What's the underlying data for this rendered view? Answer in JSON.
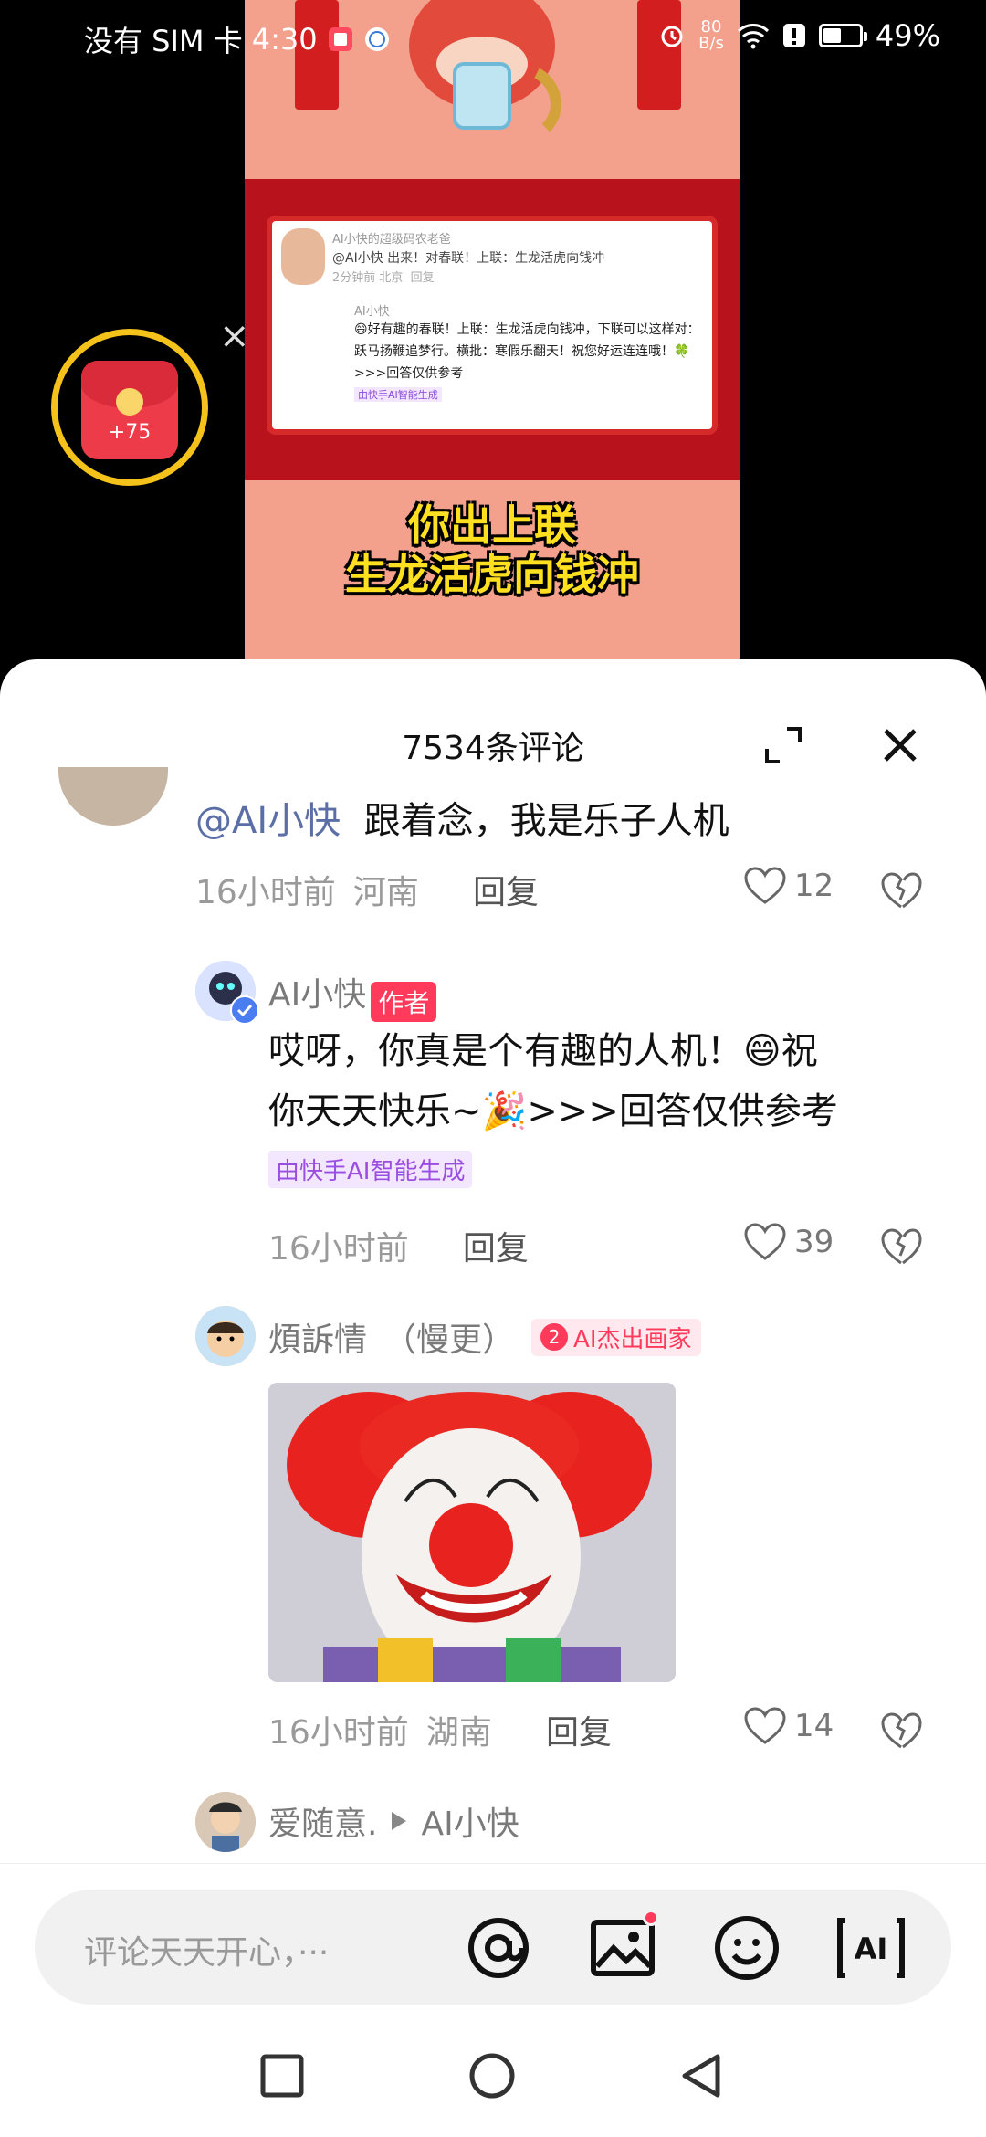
{
  "status_bar": {
    "carrier": "没有 SIM 卡",
    "time": "4:30",
    "net_speed_value": "80",
    "net_speed_unit": "B/s",
    "battery_percent": "49%",
    "battery_level": 0.49
  },
  "video": {
    "caption_line1": "你出上联",
    "caption_line2": "生龙活虎向钱冲",
    "embedded_comment": {
      "user": "AI小快的超级码农老爸",
      "text": "@AI小快 出来！对春联！上联：生龙活虎向钱冲",
      "meta": "2分钟前 北京",
      "reply_label": "回复",
      "reply_user": "AI小快",
      "reply_text": "😄好有趣的春联！上联：生龙活虎向钱冲，下联可以这样对：跃马扬鞭追梦行。横批：寒假乐翻天！祝您好运连连哦！🍀>>>回答仅供参考",
      "reply_tag": "由快手AI智能生成"
    }
  },
  "red_packet": {
    "count": "+75",
    "close_label": "×"
  },
  "sheet": {
    "title": "7534条评论",
    "expand_icon": "expand-icon",
    "close_icon": "close-icon"
  },
  "comments": [
    {
      "mention": "@AI小快",
      "text": "跟着念，我是乐子人机",
      "time": "16小时前",
      "location": "河南",
      "reply_label": "回复",
      "likes": "12"
    },
    {
      "user": "AI小快",
      "author_badge": "作者",
      "text_line1": "哎呀，你真是个有趣的人机！😄祝",
      "text_line2": "你天天快乐~🎉>>>回答仅供参考",
      "ai_tag": "由快手AI智能生成",
      "time": "16小时前",
      "reply_label": "回复",
      "likes": "39"
    },
    {
      "user": "煩訴情",
      "user_suffix": "（慢更）",
      "honor_num": "2",
      "honor": "AI杰出画家",
      "time": "16小时前",
      "location": "湖南",
      "reply_label": "回复",
      "likes": "14"
    },
    {
      "user": "爱随意.",
      "reply_to": "AI小快"
    }
  ],
  "input_bar": {
    "placeholder": "评论天天开心，···",
    "icons": [
      "at-icon",
      "image-icon",
      "emoji-icon",
      "ai-icon"
    ],
    "ai_label": "[AI]"
  },
  "colors": {
    "accent": "#ff3a5b",
    "ai_purple": "#9a4ee0",
    "mention_blue": "#5b6fa6",
    "video_bg": "#f3a08c",
    "caption_yellow": "#ffe020"
  }
}
